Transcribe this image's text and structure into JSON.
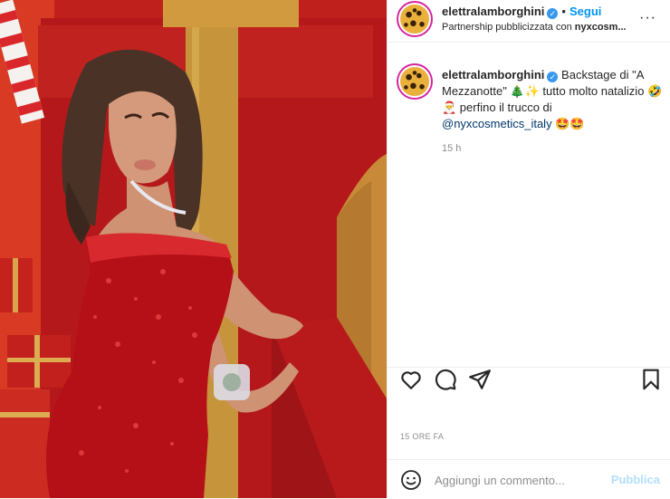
{
  "post": {
    "photo_alt": "elettralamborghini"
  },
  "header": {
    "username": "elettralamborghini",
    "dot": "•",
    "follow_label": "Segui",
    "partnership_prefix": "Partnership pubblicizzata con ",
    "partner_name": "nyxcosm...",
    "more_label": "···"
  },
  "caption": {
    "username": "elettralamborghini",
    "text_part1": "Backstage di \"A Mezzanotte\" 🎄✨ tutto molto natalizio 🤣🎅 perfino il trucco di ",
    "mention": "@nyxcosmetics_italy",
    "text_part2": " 🤩🤩",
    "time_ago": "15 h"
  },
  "actions": {
    "like": "heart-icon",
    "comment": "comment-icon",
    "share": "share-icon",
    "save": "bookmark-icon"
  },
  "post_date": "15 ORE FA",
  "comment_box": {
    "placeholder": "Aggiungi un commento...",
    "publish_label": "Pubblica"
  },
  "colors": {
    "link_blue": "#0095f6",
    "publish_disabled": "#b2dffc",
    "meta_gray": "#8e8e8e"
  }
}
